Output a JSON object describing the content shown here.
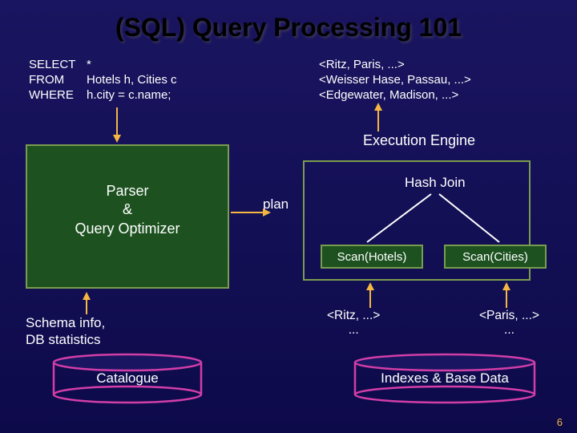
{
  "title": "(SQL) Query Processing 101",
  "sql": {
    "select_kw": "SELECT",
    "select_v": "*",
    "from_kw": "FROM",
    "from_v": "Hotels h, Cities c",
    "where_kw": "WHERE",
    "where_v": "h.city = c.name;"
  },
  "results": {
    "r1": "<Ritz, Paris, ...>",
    "r2": "<Weisser Hase, Passau, ...>",
    "r3": "<Edgewater, Madison, ...>"
  },
  "parser": {
    "l1": "Parser",
    "l2": "&",
    "l3": "Query Optimizer"
  },
  "exec_engine": "Execution Engine",
  "plan_label": "plan",
  "hash_join": "Hash Join",
  "scan_hotels": "Scan(Hotels)",
  "scan_cities": "Scan(Cities)",
  "schema": {
    "l1": "Schema info,",
    "l2": "DB statistics"
  },
  "mini": {
    "ritz_l1": "<Ritz, ...>",
    "ritz_l2": "...",
    "paris_l1": "<Paris, ...>",
    "paris_l2": "..."
  },
  "catalogue": "Catalogue",
  "indexes": "Indexes & Base Data",
  "pagenum": "6",
  "colors": {
    "accent_border": "#7a9c4e",
    "box_fill": "#1d5220",
    "cylinder": "#d23ea8"
  }
}
